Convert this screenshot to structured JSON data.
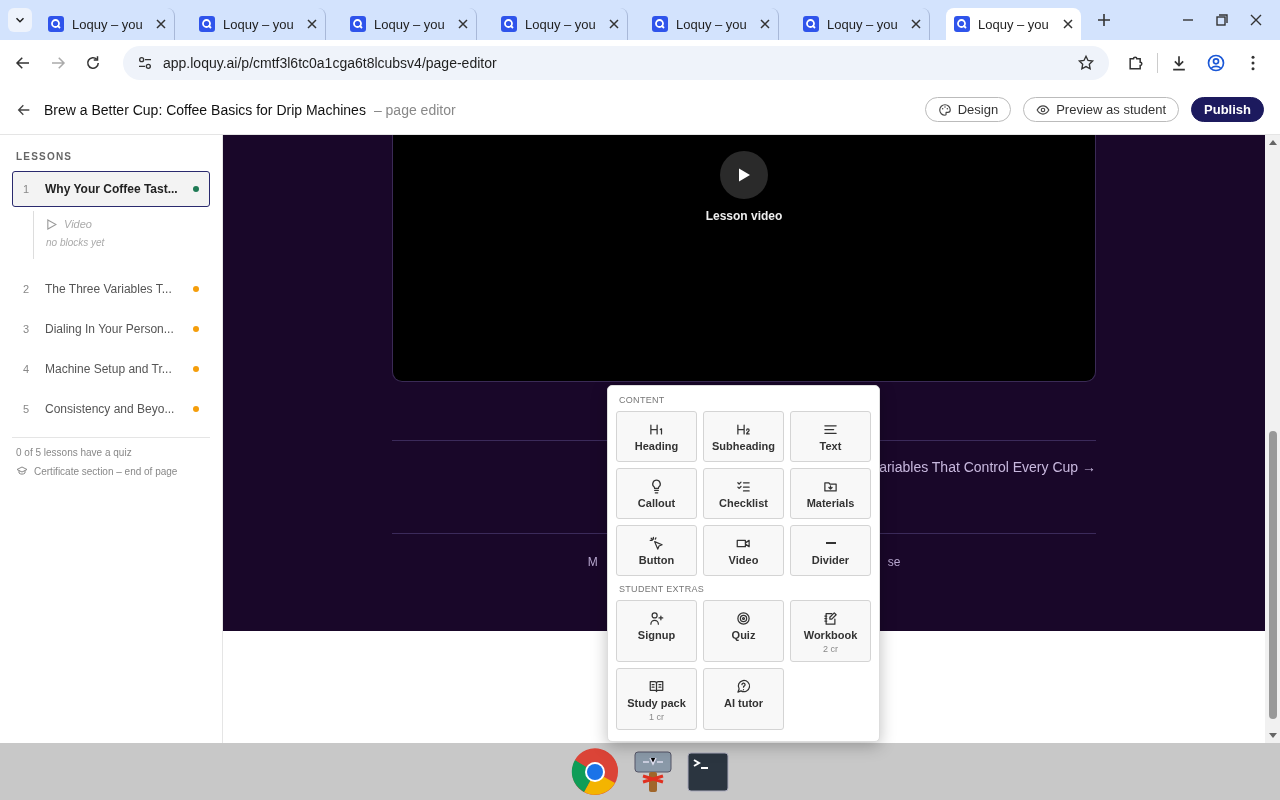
{
  "browser": {
    "tabs": [
      {
        "title": "Loquy – you",
        "selected": false
      },
      {
        "title": "Loquy – you",
        "selected": false
      },
      {
        "title": "Loquy – you",
        "selected": false
      },
      {
        "title": "Loquy – you",
        "selected": false
      },
      {
        "title": "Loquy – you",
        "selected": false
      },
      {
        "title": "Loquy – you",
        "selected": false
      },
      {
        "title": "Loquy – you",
        "selected": true
      }
    ],
    "url": "app.loquy.ai/p/cmtf3l6tc0a1cga6t8lcubsv4/page-editor"
  },
  "header": {
    "title": "Brew a Better Cup: Coffee Basics for Drip Machines",
    "subtitle": "– page editor",
    "buttons": [
      {
        "label": "Design",
        "kind": "design"
      },
      {
        "label": "Preview as student",
        "kind": "preview"
      },
      {
        "label": "Publish",
        "kind": "publish"
      }
    ]
  },
  "sidebar": {
    "heading": "LESSONS",
    "lessons": [
      {
        "number": "1",
        "title": "Why Your Coffee Tast...",
        "color": "#1f7a55",
        "selected": true,
        "children": [
          {
            "label": "Video"
          }
        ],
        "note": "no blocks yet"
      },
      {
        "number": "2",
        "title": "The Three Variables T...",
        "color": "#f59e0b",
        "selected": false
      },
      {
        "number": "3",
        "title": "Dialing In Your Person...",
        "color": "#f59e0b",
        "selected": false
      },
      {
        "number": "4",
        "title": "Machine Setup and Tr...",
        "color": "#f59e0b",
        "selected": false
      },
      {
        "number": "5",
        "title": "Consistency and Beyo...",
        "color": "#f59e0b",
        "selected": false
      }
    ],
    "quiz_note": "0 of 5 lessons have a quiz",
    "certificate_note": "Certificate section – end of page"
  },
  "canvas": {
    "video_label": "Lesson video",
    "next_link": "ariables That Control Every Cup →",
    "footer_left": "M",
    "footer_right": "se"
  },
  "block_menu": {
    "sections": [
      {
        "title": "CONTENT",
        "items": [
          {
            "label": "Heading"
          },
          {
            "label": "Subheading"
          },
          {
            "label": "Text"
          },
          {
            "label": "Callout"
          },
          {
            "label": "Checklist"
          },
          {
            "label": "Materials"
          },
          {
            "label": "Button"
          },
          {
            "label": "Video"
          },
          {
            "label": "Divider"
          }
        ]
      },
      {
        "title": "STUDENT EXTRAS",
        "items": [
          {
            "label": "Signup"
          },
          {
            "label": "Quiz"
          },
          {
            "label": "Workbook",
            "cost": "2 cr"
          },
          {
            "label": "Study pack",
            "cost": "1 cr"
          },
          {
            "label": "AI tutor"
          }
        ]
      }
    ]
  }
}
